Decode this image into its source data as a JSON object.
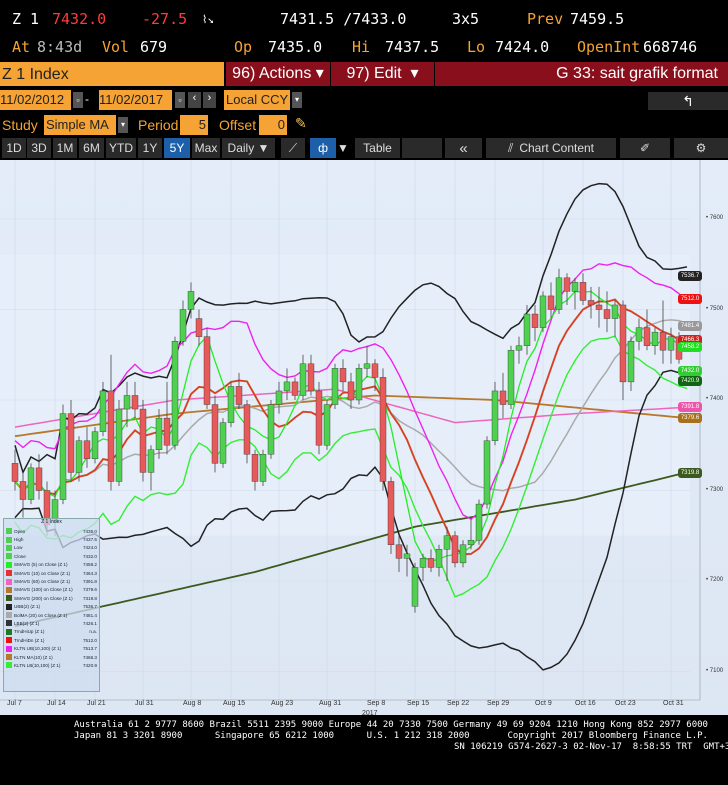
{
  "quote": {
    "ticker": "Z 1",
    "last": "7432.0",
    "change": "-27.5",
    "bid_ask": "7431.5 /7433.0",
    "size": "3x5",
    "prev_label": "Prev",
    "prev": "7459.5",
    "at_label": "At",
    "time": "8:43d",
    "vol_label": "Vol",
    "vol": "679",
    "op_label": "Op",
    "op": "7435.0",
    "hi_label": "Hi",
    "hi": "7437.5",
    "lo_label": "Lo",
    "lo": "7424.0",
    "oi_label": "OpenInt",
    "oi": "668746"
  },
  "toolbar": {
    "security": "Z 1 Index",
    "actions": "96) Actions",
    "edit": "97) Edit",
    "page": "G 33: sait grafik format",
    "start_date": "11/02/2012",
    "end_date": "11/02/2017",
    "currency": "Local CCY",
    "study_label": "Study",
    "study": "Simple MA",
    "period_label": "Period",
    "period": "5",
    "offset_label": "Offset",
    "offset": "0",
    "ranges": [
      "1D",
      "3D",
      "1M",
      "6M",
      "YTD",
      "1Y",
      "5Y",
      "Max"
    ],
    "selected_range": "5Y",
    "frequency": "Daily ▼",
    "table": "Table",
    "collapse": "«",
    "chart_content": "Chart Content"
  },
  "chart_data": {
    "type": "candlestick",
    "x_ticks": [
      "Jul 7",
      "Jul 14",
      "Jul 21",
      "Jul 31",
      "Aug 8",
      "Aug 15",
      "Aug 23",
      "Aug 31",
      "Sep 8",
      "Sep 15",
      "Sep 22",
      "Sep 29",
      "Oct 9",
      "Oct 16",
      "Oct 23",
      "Oct 31"
    ],
    "x_tick_index": [
      0,
      5,
      10,
      16,
      22,
      27,
      33,
      39,
      45,
      50,
      55,
      60,
      66,
      71,
      76,
      82
    ],
    "year_label": "2017",
    "y_ticks": [
      7100,
      7200,
      7300,
      7400,
      7500,
      7600
    ],
    "ylim": [
      7040,
      7660
    ],
    "colors": {
      "up": "#4fd14f",
      "down": "#e85a5a"
    },
    "candles": [
      [
        7330,
        7345,
        7300,
        7310
      ],
      [
        7310,
        7320,
        7270,
        7290
      ],
      [
        7290,
        7330,
        7285,
        7325
      ],
      [
        7325,
        7340,
        7290,
        7300
      ],
      [
        7300,
        7310,
        7250,
        7262
      ],
      [
        7265,
        7300,
        7250,
        7290
      ],
      [
        7290,
        7395,
        7285,
        7385
      ],
      [
        7385,
        7400,
        7310,
        7320
      ],
      [
        7320,
        7360,
        7310,
        7355
      ],
      [
        7355,
        7370,
        7325,
        7335
      ],
      [
        7335,
        7370,
        7330,
        7365
      ],
      [
        7365,
        7420,
        7360,
        7410
      ],
      [
        7410,
        7450,
        7300,
        7310
      ],
      [
        7310,
        7400,
        7305,
        7390
      ],
      [
        7390,
        7420,
        7370,
        7405
      ],
      [
        7405,
        7420,
        7380,
        7390
      ],
      [
        7390,
        7400,
        7310,
        7320
      ],
      [
        7320,
        7350,
        7300,
        7345
      ],
      [
        7345,
        7390,
        7335,
        7380
      ],
      [
        7380,
        7420,
        7340,
        7350
      ],
      [
        7350,
        7470,
        7345,
        7465
      ],
      [
        7465,
        7510,
        7460,
        7500
      ],
      [
        7500,
        7530,
        7490,
        7520
      ],
      [
        7490,
        7500,
        7460,
        7470
      ],
      [
        7470,
        7480,
        7390,
        7395
      ],
      [
        7395,
        7405,
        7320,
        7330
      ],
      [
        7330,
        7380,
        7325,
        7375
      ],
      [
        7375,
        7420,
        7370,
        7415
      ],
      [
        7415,
        7430,
        7390,
        7395
      ],
      [
        7395,
        7400,
        7330,
        7340
      ],
      [
        7340,
        7345,
        7300,
        7310
      ],
      [
        7310,
        7345,
        7305,
        7340
      ],
      [
        7340,
        7400,
        7335,
        7395
      ],
      [
        7395,
        7420,
        7385,
        7410
      ],
      [
        7410,
        7435,
        7400,
        7420
      ],
      [
        7420,
        7425,
        7400,
        7405
      ],
      [
        7405,
        7450,
        7400,
        7440
      ],
      [
        7440,
        7450,
        7405,
        7410
      ],
      [
        7410,
        7420,
        7340,
        7350
      ],
      [
        7350,
        7400,
        7345,
        7395
      ],
      [
        7395,
        7440,
        7390,
        7435
      ],
      [
        7435,
        7445,
        7410,
        7420
      ],
      [
        7420,
        7430,
        7390,
        7400
      ],
      [
        7400,
        7440,
        7395,
        7435
      ],
      [
        7435,
        7460,
        7425,
        7440
      ],
      [
        7440,
        7445,
        7410,
        7425
      ],
      [
        7425,
        7435,
        7300,
        7310
      ],
      [
        7310,
        7315,
        7230,
        7240
      ],
      [
        7240,
        7250,
        7210,
        7225
      ],
      [
        7225,
        7240,
        7205,
        7230
      ],
      [
        7172,
        7220,
        7165,
        7215
      ],
      [
        7215,
        7230,
        7200,
        7225
      ],
      [
        7225,
        7235,
        7210,
        7215
      ],
      [
        7215,
        7240,
        7205,
        7235
      ],
      [
        7235,
        7260,
        7200,
        7250
      ],
      [
        7250,
        7255,
        7215,
        7220
      ],
      [
        7220,
        7245,
        7215,
        7240
      ],
      [
        7240,
        7270,
        7235,
        7245
      ],
      [
        7245,
        7290,
        7240,
        7285
      ],
      [
        7285,
        7360,
        7280,
        7355
      ],
      [
        7355,
        7420,
        7350,
        7410
      ],
      [
        7410,
        7430,
        7380,
        7395
      ],
      [
        7395,
        7460,
        7390,
        7455
      ],
      [
        7455,
        7470,
        7440,
        7460
      ],
      [
        7460,
        7505,
        7450,
        7495
      ],
      [
        7495,
        7505,
        7465,
        7480
      ],
      [
        7480,
        7520,
        7475,
        7515
      ],
      [
        7515,
        7530,
        7490,
        7500
      ],
      [
        7500,
        7545,
        7495,
        7535
      ],
      [
        7535,
        7540,
        7505,
        7520
      ],
      [
        7520,
        7535,
        7500,
        7530
      ],
      [
        7530,
        7540,
        7505,
        7510
      ],
      [
        7510,
        7525,
        7490,
        7505
      ],
      [
        7505,
        7525,
        7480,
        7500
      ],
      [
        7500,
        7520,
        7475,
        7490
      ],
      [
        7490,
        7510,
        7470,
        7505
      ],
      [
        7505,
        7510,
        7400,
        7420
      ],
      [
        7420,
        7470,
        7410,
        7465
      ],
      [
        7465,
        7490,
        7455,
        7480
      ],
      [
        7480,
        7500,
        7455,
        7460
      ],
      [
        7460,
        7480,
        7450,
        7475
      ],
      [
        7475,
        7510,
        7440,
        7455
      ],
      [
        7455,
        7480,
        7440,
        7470
      ],
      [
        7470,
        7475,
        7440,
        7445
      ],
      [
        7435,
        7437.5,
        7424,
        7432
      ]
    ],
    "sma100": [
      [
        0,
        7360
      ],
      [
        20,
        7385
      ],
      [
        45,
        7405
      ],
      [
        60,
        7400
      ],
      [
        84,
        7380
      ]
    ],
    "sma200": [
      [
        0,
        7150
      ],
      [
        30,
        7210
      ],
      [
        50,
        7260
      ],
      [
        70,
        7290
      ],
      [
        84,
        7320
      ]
    ],
    "sma60": [
      [
        0,
        7370
      ],
      [
        20,
        7400
      ],
      [
        40,
        7412
      ],
      [
        55,
        7375
      ],
      [
        70,
        7385
      ],
      [
        84,
        7392
      ]
    ],
    "legend": {
      "title": "Z 1 Index",
      "items": [
        {
          "label": "Open",
          "value": "7435.0",
          "color": "#4fd14f"
        },
        {
          "label": "High",
          "value": "7437.5",
          "color": "#4fd14f"
        },
        {
          "label": "Low",
          "value": "7424.0",
          "color": "#4fd14f"
        },
        {
          "label": "Close",
          "value": "7432.0",
          "color": "#4fd14f"
        },
        {
          "label": "SMAVG (5) on Close (Z 1)",
          "value": "7458.2",
          "color": "#22ee22"
        },
        {
          "label": "SMAVG (10) on Close (Z 1)",
          "value": "7464.3",
          "color": "#e83030"
        },
        {
          "label": "SMAVG (60) on Close (Z 1)",
          "value": "7391.8",
          "color": "#ee66bb"
        },
        {
          "label": "SMAVG (100) on Close (Z 1)",
          "value": "7379.6",
          "color": "#b8782a"
        },
        {
          "label": "SMAVG (200) on Close (Z 1)",
          "value": "7319.8",
          "color": "#3d5a1e"
        },
        {
          "label": "UBB(2) (Z 1)",
          "value": "7536.7",
          "color": "#222222"
        },
        {
          "label": "BolMA (20) on Close (Z 1)",
          "value": "7481.4",
          "color": "#aaaaaa"
        },
        {
          "label": "LBB(2) (Z 1)",
          "value": "7426.1",
          "color": "#333333"
        },
        {
          "label": "TrndHiUp (Z 1)",
          "value": "n.a.",
          "color": "#1e7a1e"
        },
        {
          "label": "TrndHiDn (Z 1)",
          "value": "7512.0",
          "color": "#ee1111"
        },
        {
          "label": "KLTN UB(10,100) (Z 1)",
          "value": "7513.7",
          "color": "#ee22ee"
        },
        {
          "label": "KLTN MA(10) (Z 1)",
          "value": "7466.3",
          "color": "#b8782a"
        },
        {
          "label": "KLTN LB(10,100) (Z 1)",
          "value": "7420.9",
          "color": "#33ee33"
        }
      ]
    },
    "last_value_tags": [
      {
        "value": "7536.7",
        "color": "#222222"
      },
      {
        "value": "7512.0",
        "color": "#ee1111"
      },
      {
        "value": "7481.4",
        "color": "#999999"
      },
      {
        "value": "7466.3",
        "color": "#cc2222"
      },
      {
        "value": "7458.2",
        "color": "#22dd22"
      },
      {
        "value": "7432.0",
        "color": "#33cc33"
      },
      {
        "value": "7420.9",
        "color": "#116611"
      },
      {
        "value": "7391.8",
        "color": "#ee55aa"
      },
      {
        "value": "7379.6",
        "color": "#a8701a"
      },
      {
        "value": "7319.8",
        "color": "#3d5a1e"
      }
    ]
  },
  "footer": {
    "line1": "Australia 61 2 9777 8600 Brazil 5511 2395 9000 Europe 44 20 7330 7500 Germany 49 69 9204 1210 Hong Kong 852 2977 6000",
    "line2": "Japan 81 3 3201 8900      Singapore 65 6212 1000      U.S. 1 212 318 2000       Copyright 2017 Bloomberg Finance L.P.",
    "line3": "SN 106219 G574-2627-3 02-Nov-17  8:58:55 TRT  GMT+3:00"
  }
}
